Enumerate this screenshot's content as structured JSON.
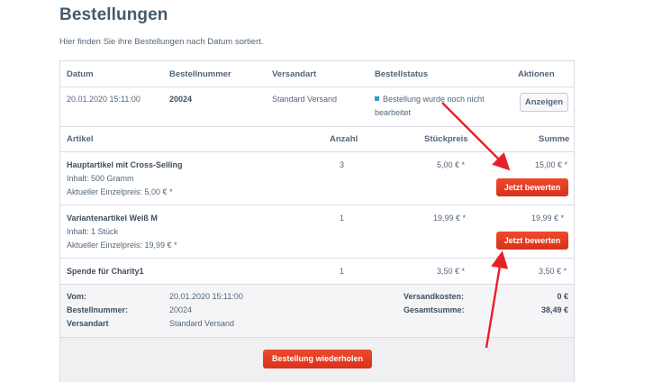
{
  "page": {
    "title": "Bestellungen",
    "subtitle": "Hier finden Sie ihre Bestellungen nach Datum sortiert."
  },
  "order_header": {
    "columns": {
      "date": "Datum",
      "number": "Bestellnummer",
      "shipping": "Versandart",
      "status": "Bestellstatus",
      "actions": "Aktionen"
    },
    "date": "20.01.2020 15:11:00",
    "number": "20024",
    "shipping": "Standard Versand",
    "status_line1": "Bestellung wurde noch nicht",
    "status_line2": "bearbeitet",
    "show_button": "Anzeigen"
  },
  "items_header": {
    "article": "Artikel",
    "qty": "Anzahl",
    "unit_price": "Stückpreis",
    "sum": "Summe"
  },
  "items": [
    {
      "name": "Hauptartikel mit Cross-Selling",
      "content": "Inhalt: 500 Gramm",
      "current_price": "Aktueller Einzelpreis: 5,00 € *",
      "qty": "3",
      "unit_price": "5,00 € *",
      "sum": "15,00 € *",
      "rate_button": "Jetzt bewerten"
    },
    {
      "name": "Variantenartikel Weiß M",
      "content": "Inhalt: 1 Stück",
      "current_price": "Aktueller Einzelpreis: 19,99 € *",
      "qty": "1",
      "unit_price": "19,99 € *",
      "sum": "19,99 € *",
      "rate_button": "Jetzt bewerten"
    },
    {
      "name": "Spende für Charity1",
      "qty": "1",
      "unit_price": "3,50 € *",
      "sum": "3,50 € *"
    }
  ],
  "summary": {
    "from_label": "Vom:",
    "from_value": "20.01.2020 15:11:00",
    "number_label": "Bestellnummer:",
    "number_value": "20024",
    "shipping_label": "Versandart",
    "shipping_value": "Standard Versand",
    "shipping_cost_label": "Versandkosten:",
    "shipping_cost_value": "0 €",
    "total_label": "Gesamtsumme:",
    "total_value": "38,49 €"
  },
  "repeat_button": "Bestellung wiederholen",
  "colors": {
    "accent_red": "#e43f24",
    "status_blue": "#3399cc",
    "text": "#52667a",
    "border": "#dadae5"
  }
}
